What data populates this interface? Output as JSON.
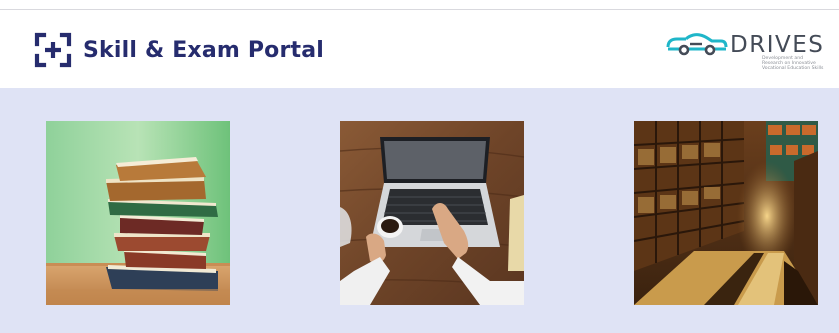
{
  "header": {
    "title": "Skill & Exam Portal",
    "icon": "plus-bracket-icon",
    "title_color": "#262c6e"
  },
  "partner_logo": {
    "name": "DRIVES",
    "tagline": "Development and Research on Innovative Vocational Education Skills",
    "accent_color": "#1fb6c9",
    "icon": "car-link-icon"
  },
  "gallery": {
    "background": "#dfe3f5",
    "images": [
      {
        "subject": "stack-of-books"
      },
      {
        "subject": "laptop-and-coffee"
      },
      {
        "subject": "library-interior"
      }
    ]
  }
}
